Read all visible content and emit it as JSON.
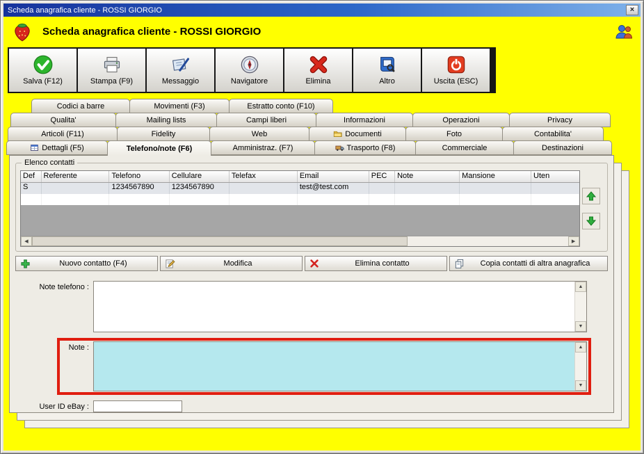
{
  "window": {
    "title": "Scheda anagrafica cliente - ROSSI GIORGIO"
  },
  "icons": {
    "close": "×",
    "up": "▲",
    "down": "▼",
    "left": "◀",
    "right": "▶"
  },
  "header": {
    "title": "Scheda anagrafica cliente - ROSSI GIORGIO"
  },
  "toolbar": {
    "items": [
      {
        "label": "Salva (F12)",
        "icon": "save-check-icon"
      },
      {
        "label": "Stampa (F9)",
        "icon": "printer-icon"
      },
      {
        "label": "Messaggio",
        "icon": "message-icon"
      },
      {
        "label": "Navigatore",
        "icon": "compass-icon"
      },
      {
        "label": "Elimina",
        "icon": "delete-x-icon"
      },
      {
        "label": "Altro",
        "icon": "book-search-icon"
      },
      {
        "label": "Uscita (ESC)",
        "icon": "power-icon"
      }
    ]
  },
  "tabs": {
    "active": "Telefono/note (F6)",
    "rows": [
      [
        "Codici a barre",
        "Movimenti (F3)",
        "Estratto conto (F10)"
      ],
      [
        "Qualita'",
        "Mailing lists",
        "Campi liberi",
        "Informazioni",
        "Operazioni",
        "Privacy"
      ],
      [
        "Articoli (F11)",
        "Fidelity",
        "Web",
        "Documenti",
        "Foto",
        "Contabilita'"
      ],
      [
        "Dettagli (F5)",
        "Telefono/note (F6)",
        "Amministraz. (F7)",
        "Trasporto (F8)",
        "Commerciale",
        "Destinazioni"
      ]
    ]
  },
  "contacts": {
    "legend": "Elenco contatti",
    "columns": [
      "Def",
      "Referente",
      "Telefono",
      "Cellulare",
      "Telefax",
      "Email",
      "PEC",
      "Note",
      "Mansione",
      "Uten"
    ],
    "rows": [
      [
        "S",
        "",
        "1234567890",
        "1234567890",
        "",
        "test@test.com",
        "",
        "",
        "",
        ""
      ]
    ],
    "actions": [
      {
        "label": "Nuovo contatto (F4)",
        "icon": "plus-icon"
      },
      {
        "label": "Modifica",
        "icon": "edit-icon"
      },
      {
        "label": "Elimina contatto",
        "icon": "delete-x-icon"
      },
      {
        "label": "Copia contatti di altra anagrafica",
        "icon": "copy-icon"
      }
    ]
  },
  "fields": {
    "note_telefono": {
      "label": "Note telefono :",
      "value": ""
    },
    "note": {
      "label": "Note :",
      "value": ""
    },
    "ebay": {
      "label": "User ID eBay :",
      "value": ""
    }
  },
  "colors": {
    "highlight_box": "#e01e10",
    "note_bg": "#b5e8ee",
    "window_bg": "#ffff00"
  }
}
